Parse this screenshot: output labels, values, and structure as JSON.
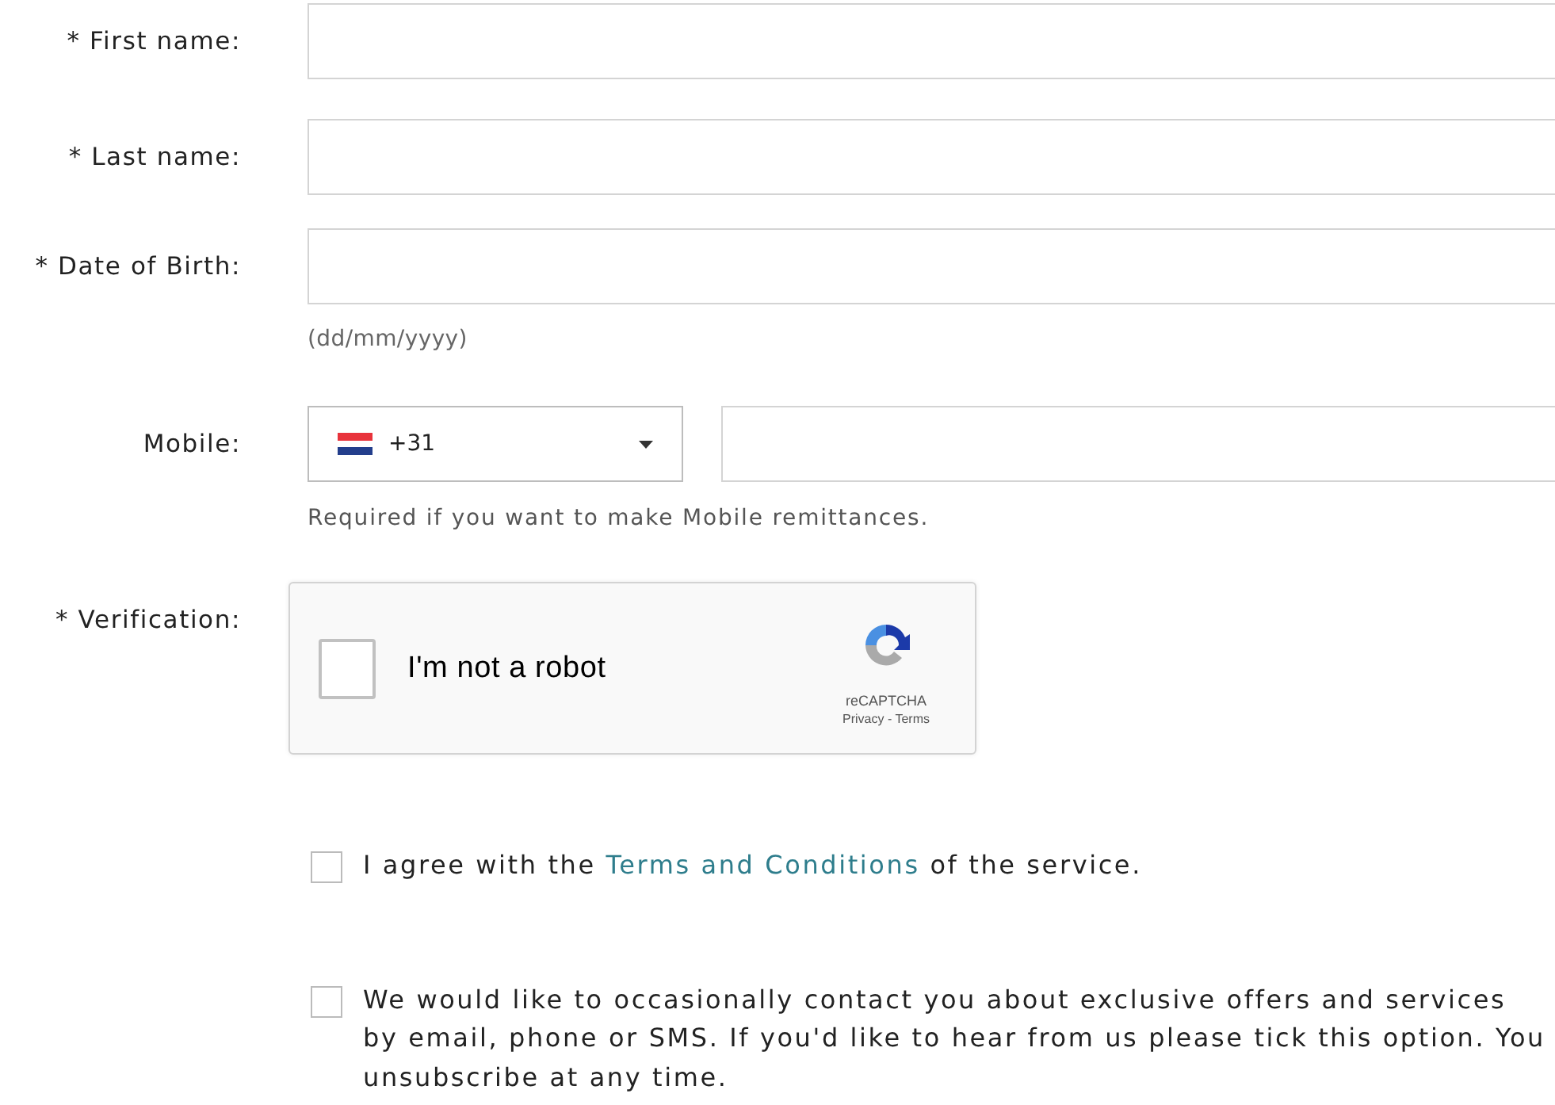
{
  "fields": [
    {
      "kind": "text",
      "label": "* First name:"
    },
    {
      "kind": "text",
      "label": "* Last name:"
    },
    {
      "kind": "text",
      "label": "* Date of Birth:",
      "hint": "(dd/mm/yyyy)"
    },
    {
      "kind": "phone",
      "label": "Mobile:",
      "code": "+31",
      "hint": "Required if you want to make Mobile remittances."
    },
    {
      "kind": "captcha",
      "label": "* Verification:",
      "checked": false,
      "text": "I'm not a robot",
      "brand": "reCAPTCHA",
      "links": "Privacy - Terms"
    }
  ],
  "consents": [
    {
      "checked": false,
      "lines": [
        [
          {
            "kind": "plain",
            "text": "I agree with the "
          },
          {
            "kind": "link",
            "text": "Terms and Conditions"
          },
          {
            "kind": "plain",
            "text": " of the service."
          }
        ]
      ]
    },
    {
      "checked": false,
      "lines": [
        [
          {
            "kind": "plain",
            "text": "We would like to occasionally contact you about exclusive offers and services"
          }
        ],
        [
          {
            "kind": "plain",
            "text": "by email, phone or SMS. If you'd like to hear from us please tick this option. You"
          }
        ],
        [
          {
            "kind": "plain",
            "text": "unsubscribe at any time."
          }
        ]
      ]
    }
  ]
}
